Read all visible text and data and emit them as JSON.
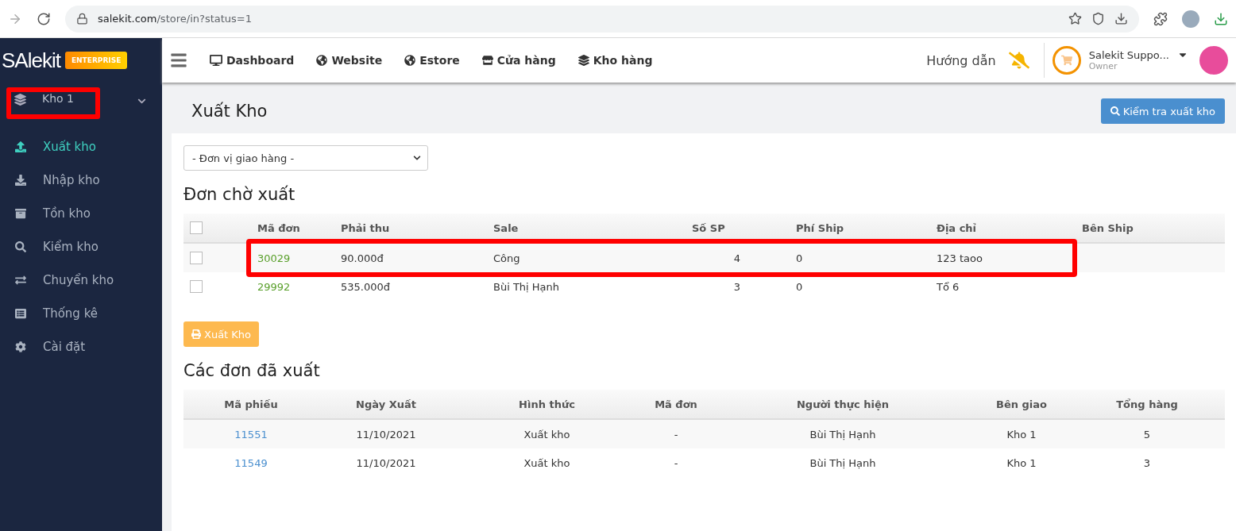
{
  "browser": {
    "url_host": "salekit.com",
    "url_path": "/store/in?status=1"
  },
  "header": {
    "logo": "SAlekit",
    "edition": "ENTERPRISE",
    "nav": [
      "Dashboard",
      "Website",
      "Estore",
      "Cửa hàng",
      "Kho hàng"
    ],
    "guide": "Hướng dẫn",
    "user": {
      "name": "Salekit Suppo...",
      "role": "Owner"
    }
  },
  "sidebar": {
    "warehouse": {
      "label": "Kho 1",
      "annotated": true
    },
    "items": [
      {
        "label": "Xuất kho",
        "selected": true
      },
      {
        "label": "Nhập kho",
        "selected": false
      },
      {
        "label": "Tồn kho",
        "selected": false
      },
      {
        "label": "Kiểm kho",
        "selected": false
      },
      {
        "label": "Chuyển kho",
        "selected": false
      },
      {
        "label": "Thống kê",
        "selected": false
      },
      {
        "label": "Cài đặt",
        "selected": false
      }
    ]
  },
  "page": {
    "title": "Xuất Kho",
    "action_button": "Kiểm tra xuất kho"
  },
  "filter": {
    "value": "- Đơn vị giao hàng -"
  },
  "pending": {
    "title": "Đơn chờ xuất",
    "all_checked": false,
    "columns": [
      "Mã đơn",
      "Phải thu",
      "Sale",
      "Số SP",
      "Phí Ship",
      "Địa chỉ",
      "Bên Ship"
    ],
    "rows": [
      {
        "checked": false,
        "annotated": true,
        "cells": [
          "30029",
          "90.000đ",
          "Công",
          "4",
          "0",
          "123 taoo",
          ""
        ]
      },
      {
        "checked": false,
        "annotated": false,
        "cells": [
          "29992",
          "535.000đ",
          "Bùi Thị Hạnh",
          "3",
          "0",
          "Tổ 6",
          ""
        ]
      }
    ],
    "button": "Xuất Kho"
  },
  "exported": {
    "title": "Các đơn đã xuất",
    "columns": [
      "Mã phiếu",
      "Ngày Xuất",
      "Hình thức",
      "Mã đơn",
      "Người thực hiện",
      "Bên giao",
      "Tổng hàng"
    ],
    "rows": [
      [
        "11551",
        "11/10/2021",
        "Xuất kho",
        "-",
        "Bùi Thị Hạnh",
        "Kho 1",
        "5"
      ],
      [
        "11549",
        "11/10/2021",
        "Xuất kho",
        "-",
        "Bùi Thị Hạnh",
        "Kho 1",
        "3"
      ]
    ]
  }
}
